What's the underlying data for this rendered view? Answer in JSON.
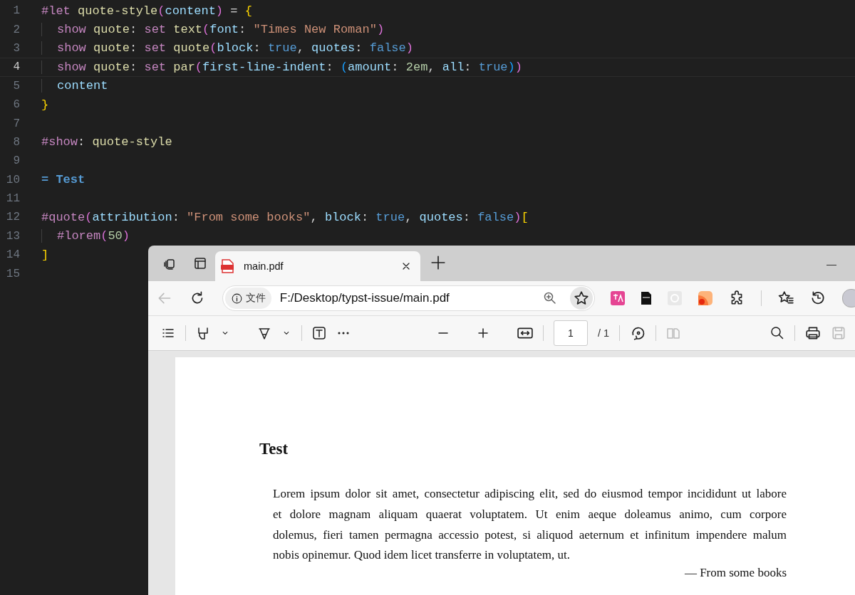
{
  "editor": {
    "lines": [
      {
        "number": "1",
        "current": false,
        "indented": false,
        "tokens": [
          {
            "text": "#let ",
            "kind": "keyword"
          },
          {
            "text": "quote-style",
            "kind": "func"
          },
          {
            "text": "(",
            "kind": "brace1"
          },
          {
            "text": "content",
            "kind": "param"
          },
          {
            "text": ")",
            "kind": "brace1"
          },
          {
            "text": " = ",
            "kind": "plain"
          },
          {
            "text": "{",
            "kind": "brace0"
          }
        ]
      },
      {
        "number": "2",
        "current": false,
        "indented": true,
        "tokens": [
          {
            "text": "show ",
            "kind": "keyword"
          },
          {
            "text": "quote",
            "kind": "func"
          },
          {
            "text": ": ",
            "kind": "plain"
          },
          {
            "text": "set ",
            "kind": "keyword"
          },
          {
            "text": "text",
            "kind": "func"
          },
          {
            "text": "(",
            "kind": "brace1"
          },
          {
            "text": "font",
            "kind": "param"
          },
          {
            "text": ": ",
            "kind": "plain"
          },
          {
            "text": "\"Times New Roman\"",
            "kind": "string"
          },
          {
            "text": ")",
            "kind": "brace1"
          }
        ]
      },
      {
        "number": "3",
        "current": false,
        "indented": true,
        "tokens": [
          {
            "text": "show ",
            "kind": "keyword"
          },
          {
            "text": "quote",
            "kind": "func"
          },
          {
            "text": ": ",
            "kind": "plain"
          },
          {
            "text": "set ",
            "kind": "keyword"
          },
          {
            "text": "quote",
            "kind": "func"
          },
          {
            "text": "(",
            "kind": "brace1"
          },
          {
            "text": "block",
            "kind": "param"
          },
          {
            "text": ": ",
            "kind": "plain"
          },
          {
            "text": "true",
            "kind": "bool"
          },
          {
            "text": ", ",
            "kind": "plain"
          },
          {
            "text": "quotes",
            "kind": "param"
          },
          {
            "text": ": ",
            "kind": "plain"
          },
          {
            "text": "false",
            "kind": "bool"
          },
          {
            "text": ")",
            "kind": "brace1"
          }
        ]
      },
      {
        "number": "4",
        "current": true,
        "indented": true,
        "tokens": [
          {
            "text": "show ",
            "kind": "keyword"
          },
          {
            "text": "quote",
            "kind": "func"
          },
          {
            "text": ": ",
            "kind": "plain"
          },
          {
            "text": "set ",
            "kind": "keyword"
          },
          {
            "text": "par",
            "kind": "func"
          },
          {
            "text": "(",
            "kind": "brace1"
          },
          {
            "text": "first-line-indent",
            "kind": "param"
          },
          {
            "text": ": ",
            "kind": "plain"
          },
          {
            "text": "(",
            "kind": "brace2"
          },
          {
            "text": "amount",
            "kind": "param"
          },
          {
            "text": ": ",
            "kind": "plain"
          },
          {
            "text": "2em",
            "kind": "number"
          },
          {
            "text": ", ",
            "kind": "plain"
          },
          {
            "text": "all",
            "kind": "param"
          },
          {
            "text": ": ",
            "kind": "plain"
          },
          {
            "text": "true",
            "kind": "bool"
          },
          {
            "text": ")",
            "kind": "brace2"
          },
          {
            "text": ")",
            "kind": "brace1"
          }
        ]
      },
      {
        "number": "5",
        "current": false,
        "indented": true,
        "tokens": [
          {
            "text": "content",
            "kind": "param"
          }
        ]
      },
      {
        "number": "6",
        "current": false,
        "indented": false,
        "tokens": [
          {
            "text": "}",
            "kind": "brace0"
          }
        ]
      },
      {
        "number": "7",
        "current": false
      },
      {
        "number": "8",
        "current": false,
        "indented": false,
        "tokens": [
          {
            "text": "#show",
            "kind": "keyword"
          },
          {
            "text": ": ",
            "kind": "plain"
          },
          {
            "text": "quote-style",
            "kind": "func"
          }
        ]
      },
      {
        "number": "9",
        "current": false
      },
      {
        "number": "10",
        "current": false,
        "indented": false,
        "tokens": [
          {
            "text": "= Test",
            "kind": "heading"
          }
        ]
      },
      {
        "number": "11",
        "current": false
      },
      {
        "number": "12",
        "current": false,
        "indented": false,
        "tokens": [
          {
            "text": "#quote",
            "kind": "keyword"
          },
          {
            "text": "(",
            "kind": "brace1"
          },
          {
            "text": "attribution",
            "kind": "param"
          },
          {
            "text": ": ",
            "kind": "plain"
          },
          {
            "text": "\"From some books\"",
            "kind": "string"
          },
          {
            "text": ", ",
            "kind": "plain"
          },
          {
            "text": "block",
            "kind": "param"
          },
          {
            "text": ": ",
            "kind": "plain"
          },
          {
            "text": "true",
            "kind": "bool"
          },
          {
            "text": ", ",
            "kind": "plain"
          },
          {
            "text": "quotes",
            "kind": "param"
          },
          {
            "text": ": ",
            "kind": "plain"
          },
          {
            "text": "false",
            "kind": "bool"
          },
          {
            "text": ")",
            "kind": "brace1"
          },
          {
            "text": "[",
            "kind": "brace0"
          }
        ]
      },
      {
        "number": "13",
        "current": false,
        "indented": true,
        "tokens": [
          {
            "text": "#lorem",
            "kind": "keyword"
          },
          {
            "text": "(",
            "kind": "brace1"
          },
          {
            "text": "50",
            "kind": "number"
          },
          {
            "text": ")",
            "kind": "brace1"
          }
        ]
      },
      {
        "number": "14",
        "current": false,
        "indented": false,
        "tokens": [
          {
            "text": "]",
            "kind": "brace0"
          }
        ]
      },
      {
        "number": "15",
        "current": false
      }
    ]
  },
  "browser": {
    "tab_title": "main.pdf",
    "address": {
      "badge": "文件",
      "url": "F:/Desktop/typst-issue/main.pdf"
    },
    "pdf_toolbar": {
      "page": "1",
      "total": "/ 1"
    },
    "document": {
      "heading": "Test",
      "lines": [
        "Lorem ipsum dolor sit amet, consectetur adipiscing elit, sed do eiusmod tempor incididunt ut labore",
        "et dolore magnam aliquam quaerat voluptatem. Ut enim aeque doleamus animo, cum corpore",
        "dolemus, fieri tamen permagna accessio potest, si aliquod aeternum et infinitum impendere malum",
        "nobis opinemur. Quod idem licet transferre in voluptatem, ut."
      ],
      "attribution": "— From some books"
    }
  }
}
